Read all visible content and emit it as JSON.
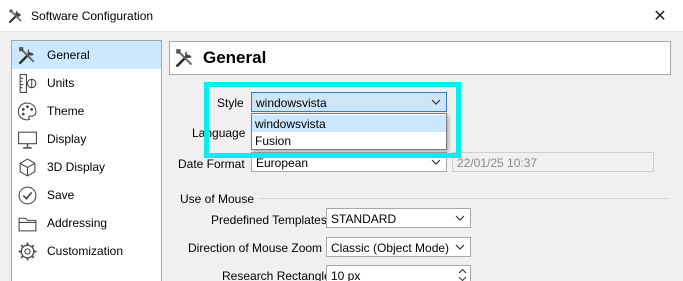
{
  "window": {
    "title": "Software Configuration",
    "close_glyph": "✕",
    "icon": "tools-icon"
  },
  "sidebar": {
    "items": [
      {
        "label": "General",
        "icon": "tools-icon",
        "selected": true
      },
      {
        "label": "Units",
        "icon": "ruler-icon"
      },
      {
        "label": "Theme",
        "icon": "palette-icon"
      },
      {
        "label": "Display",
        "icon": "monitor-icon"
      },
      {
        "label": "3D Display",
        "icon": "cube-icon"
      },
      {
        "label": "Save",
        "icon": "save-icon"
      },
      {
        "label": "Addressing",
        "icon": "folder-icon"
      },
      {
        "label": "Customization",
        "icon": "gear-icon"
      }
    ]
  },
  "header": {
    "title": "General",
    "icon": "tools-icon"
  },
  "form": {
    "style_label": "Style",
    "style_value": "windowsvista",
    "style_options": [
      "windowsvista",
      "Fusion"
    ],
    "language_label": "Language",
    "date_format_label": "Date Format",
    "date_format_value": "European",
    "date_preview": "22/01/25 10:37",
    "mouse_section": "Use of Mouse",
    "templates_label": "Predefined Templates",
    "templates_value": "STANDARD",
    "zoom_label": "Direction of Mouse Zoom",
    "zoom_value": "Classic (Object Mode)",
    "research_label": "Research Rectangle",
    "research_value": "10 px"
  },
  "colors": {
    "highlight": "#00f0f0",
    "selection": "#cce8ff",
    "active_combo": "#cde6f7"
  }
}
